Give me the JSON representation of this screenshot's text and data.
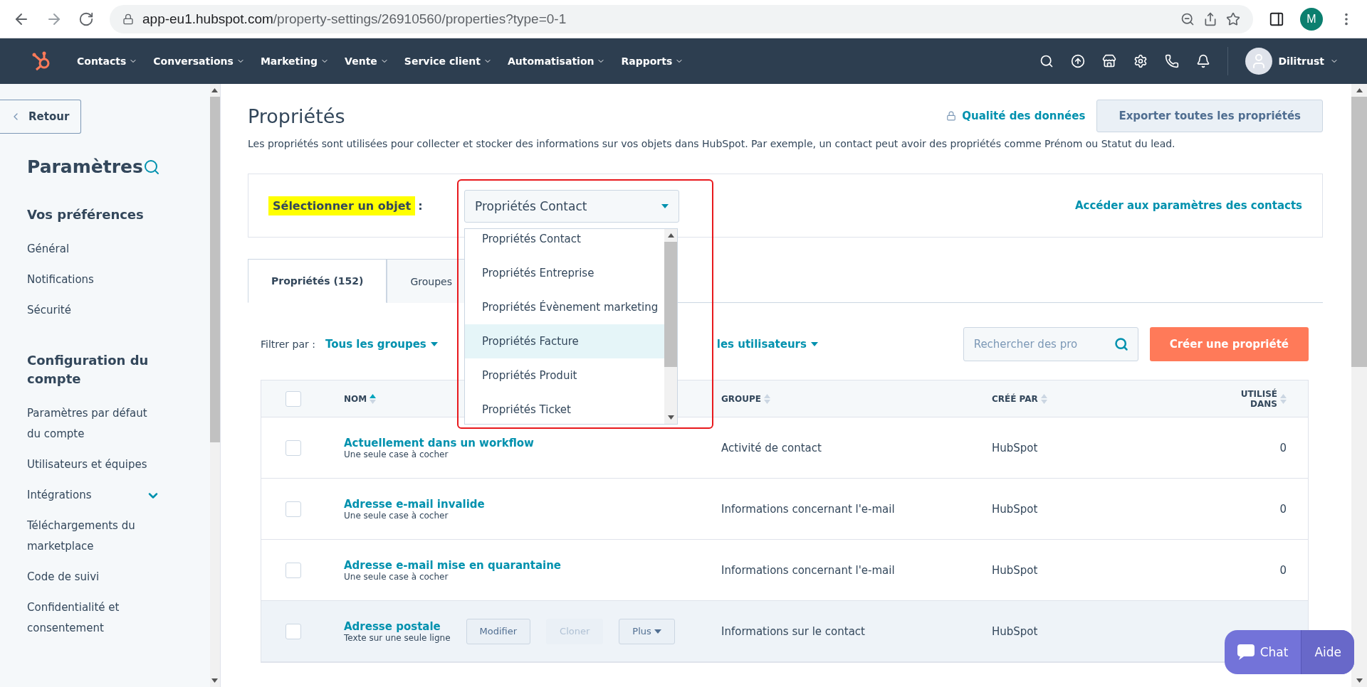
{
  "browser": {
    "url_host": "app-eu1.hubspot.com",
    "url_path": "/property-settings/26910560/properties?type=0-1",
    "profile": "M"
  },
  "nav": {
    "items": [
      "Contacts",
      "Conversations",
      "Marketing",
      "Vente",
      "Service client",
      "Automatisation",
      "Rapports"
    ],
    "account": "Dilitrust"
  },
  "sidebar": {
    "back": "Retour",
    "title": "Paramètres",
    "sections": [
      {
        "heading": "Vos préférences",
        "items": [
          {
            "label": "Général"
          },
          {
            "label": "Notifications"
          },
          {
            "label": "Sécurité"
          }
        ]
      },
      {
        "heading": "Configuration du compte",
        "items": [
          {
            "label": "Paramètres par défaut du compte"
          },
          {
            "label": "Utilisateurs et équipes"
          },
          {
            "label": "Intégrations",
            "expandable": true
          },
          {
            "label": "Téléchargements du marketplace"
          },
          {
            "label": "Code de suivi"
          },
          {
            "label": "Confidentialité et consentement"
          }
        ]
      }
    ]
  },
  "page": {
    "title": "Propriétés",
    "quality_link": "Qualité des données",
    "export_button": "Exporter toutes les propriétés",
    "description": "Les propriétés sont utilisées pour collecter et stocker des informations sur vos objets dans HubSpot. Par exemple, un contact peut avoir des propriétés comme Prénom ou Statut du lead."
  },
  "object_select": {
    "label": "Sélectionner un objet",
    "highlighted": true,
    "separator": ":",
    "value": "Propriétés Contact",
    "settings_link": "Accéder aux paramètres des contacts",
    "options": [
      {
        "label": "Propriétés Contact",
        "highlighted": false
      },
      {
        "label": "Propriétés Entreprise",
        "highlighted": false
      },
      {
        "label": "Propriétés Évènement marketing",
        "highlighted": false
      },
      {
        "label": "Propriétés Facture",
        "highlighted": true
      },
      {
        "label": "Propriétés Produit",
        "highlighted": false
      },
      {
        "label": "Propriétés Ticket",
        "highlighted": false
      }
    ]
  },
  "tabs": [
    {
      "label": "Propriétés (152)",
      "selected": true
    },
    {
      "label": "Groupes",
      "selected": false
    }
  ],
  "filters": {
    "label": "Filtrer par :",
    "group_filter": "Tous les groupes",
    "user_filter": "les utilisateurs",
    "search_placeholder": "Rechercher des pro",
    "create_button": "Créer une propriété"
  },
  "table": {
    "select_all_checked": false,
    "columns": [
      "NOM",
      "GROUPE",
      "CRÉÉ PAR",
      "UTILISÉ DANS"
    ],
    "rows": [
      {
        "name": "Actuellement dans un workflow",
        "type": "Une seule case à cocher",
        "group": "Activité de contact",
        "created_by": "HubSpot",
        "used_in": "0",
        "hovered": false,
        "checked": false
      },
      {
        "name": "Adresse e-mail invalide",
        "type": "Une seule case à cocher",
        "group": "Informations concernant l'e-mail",
        "created_by": "HubSpot",
        "used_in": "0",
        "hovered": false,
        "checked": false
      },
      {
        "name": "Adresse e-mail mise en quarantaine",
        "type": "Une seule case à cocher",
        "group": "Informations concernant l'e-mail",
        "created_by": "HubSpot",
        "used_in": "0",
        "hovered": false,
        "checked": false
      },
      {
        "name": "Adresse postale",
        "type": "Texte sur une seule ligne",
        "group": "Informations sur le contact",
        "created_by": "HubSpot",
        "hovered": true,
        "checked": false,
        "actions": [
          {
            "label": "Modifier",
            "disabled": false,
            "kind": "button"
          },
          {
            "label": "Cloner",
            "disabled": true,
            "kind": "button"
          },
          {
            "label": "Plus",
            "disabled": false,
            "kind": "menu"
          }
        ]
      }
    ]
  },
  "chat": {
    "chat": "Chat",
    "help": "Aide"
  }
}
